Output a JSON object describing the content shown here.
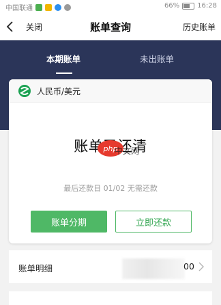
{
  "status_bar": {
    "carrier": "中国联通",
    "battery": "66%",
    "time": "16:28"
  },
  "nav": {
    "close_label": "关闭",
    "title": "账单查询",
    "history_label": "历史账单"
  },
  "tabs": [
    {
      "label": "本期账单",
      "active": true
    },
    {
      "label": "未出账单",
      "active": false
    }
  ],
  "card": {
    "currency": "人民币/美元",
    "status": "账单已还清",
    "watermark_text": "中文网",
    "due_line": "最后还款日 01/02   无需还款",
    "installment_button": "账单分期",
    "repay_button": "立即还款"
  },
  "detail": {
    "label": "账单明细",
    "amount_visible": "00"
  },
  "colors": {
    "header_bg": "#2b3559",
    "accent_green": "#4fb866",
    "bank_logo_green": "#1aa151"
  },
  "icons": {
    "back": "chevron-left-icon",
    "bank": "bank-logo-icon",
    "detail_arrow": "chevron-right-icon"
  }
}
